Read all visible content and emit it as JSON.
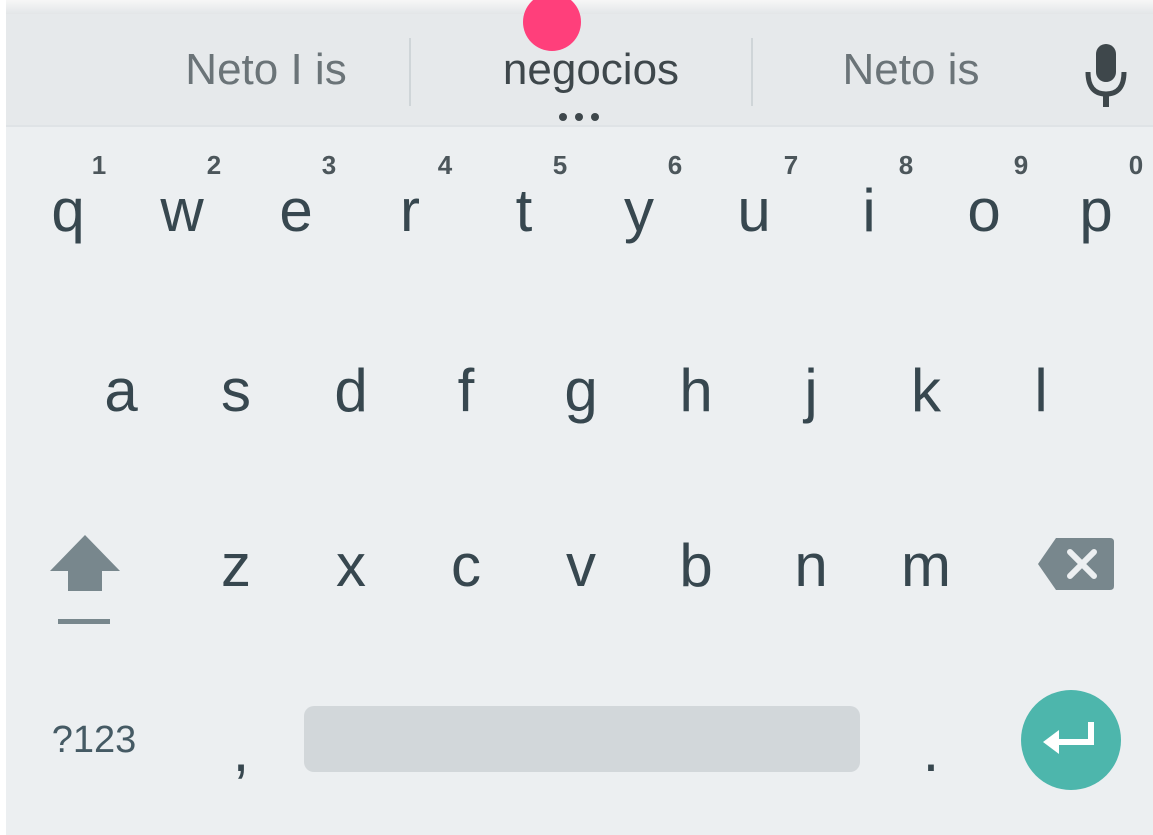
{
  "suggestions": {
    "items": [
      "Neto I is",
      "negocios",
      "Neto is"
    ],
    "more_indicator": "more-dots-icon"
  },
  "keyboard": {
    "row1": [
      {
        "letter": "q",
        "hint": "1"
      },
      {
        "letter": "w",
        "hint": "2"
      },
      {
        "letter": "e",
        "hint": "3"
      },
      {
        "letter": "r",
        "hint": "4"
      },
      {
        "letter": "t",
        "hint": "5"
      },
      {
        "letter": "y",
        "hint": "6"
      },
      {
        "letter": "u",
        "hint": "7"
      },
      {
        "letter": "i",
        "hint": "8"
      },
      {
        "letter": "o",
        "hint": "9"
      },
      {
        "letter": "p",
        "hint": "0"
      }
    ],
    "row2": [
      "a",
      "s",
      "d",
      "f",
      "g",
      "h",
      "j",
      "k",
      "l"
    ],
    "row3": [
      "z",
      "x",
      "c",
      "v",
      "b",
      "n",
      "m"
    ],
    "bottom": {
      "symbols_label": "?123",
      "comma": ",",
      "period": "."
    },
    "icons": {
      "shift": "shift-icon",
      "backspace": "backspace-icon",
      "enter": "enter-icon",
      "mic": "microphone-icon"
    }
  },
  "colors": {
    "background": "#eceff1",
    "suggestion_bar": "#e6e9eb",
    "key_text": "#37474f",
    "enter_key": "#4db6ac",
    "space_bar": "#d2d7da",
    "touch_indicator": "#ff3f7b"
  }
}
